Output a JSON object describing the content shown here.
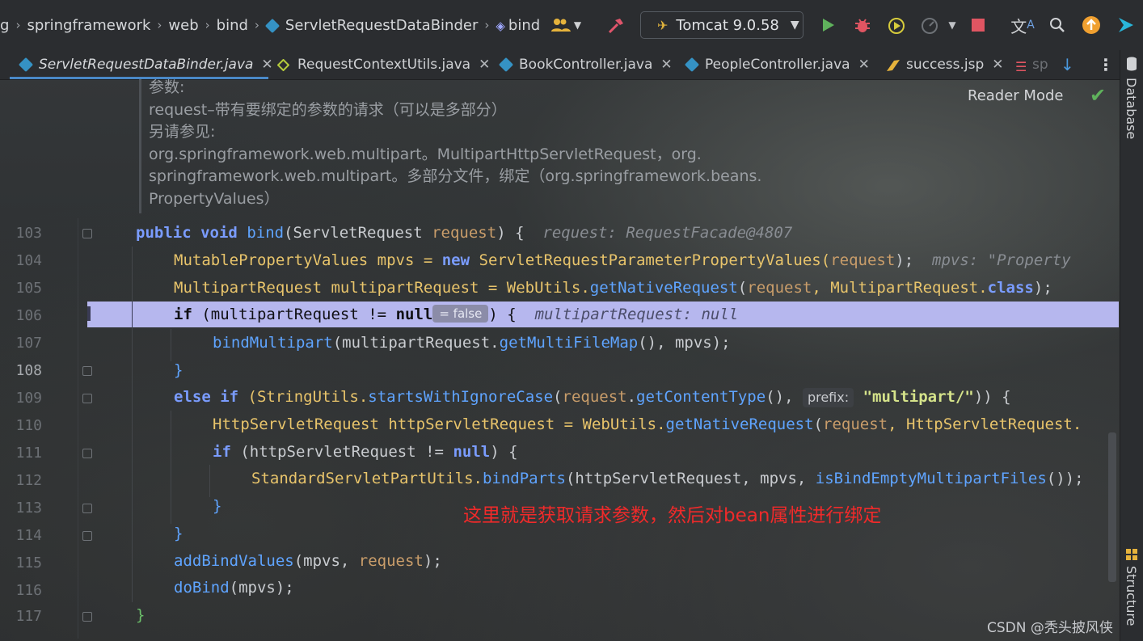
{
  "breadcrumbs": {
    "left_cut": "g",
    "items": [
      "springframework",
      "web",
      "bind",
      "ServletRequestDataBinder",
      "bind"
    ]
  },
  "toolbar": {
    "run_config": "Tomcat 9.0.58"
  },
  "tabs": [
    {
      "label": "ServletRequestDataBinder.java",
      "active": true,
      "icon": "java-class-icon"
    },
    {
      "label": "RequestContextUtils.java",
      "active": false,
      "icon": "java-abstract-class-icon"
    },
    {
      "label": "BookController.java",
      "active": false,
      "icon": "java-class-icon"
    },
    {
      "label": "PeopleController.java",
      "active": false,
      "icon": "java-class-icon"
    },
    {
      "label": "success.jsp",
      "active": false,
      "icon": "jsp-icon"
    },
    {
      "label": "sp",
      "active": false,
      "icon": "list-icon"
    }
  ],
  "side_panels": {
    "database": "Database",
    "structure": "Structure"
  },
  "reader_mode": "Reader Mode",
  "javadoc": [
    "参数:",
    "request–带有要绑定的参数的请求（可以是多部分）",
    "另请参见:",
    "org.springframework.web.multipart。MultipartHttpServletRequest，org.",
    "springframework.web.multipart。多部分文件，绑定（org.springframework.beans.",
    "PropertyValues）"
  ],
  "line_numbers": [
    "103",
    "104",
    "105",
    "106",
    "107",
    "108",
    "109",
    "110",
    "111",
    "112",
    "113",
    "114",
    "115",
    "116",
    "117"
  ],
  "code": {
    "l103": {
      "public": "public",
      "void": "void",
      "name": "bind",
      "params": "(ServletRequest ",
      "param": "request",
      "close": ") {",
      "hint": "request: RequestFacade@4807"
    },
    "l104": {
      "text1": "MutablePropertyValues mpvs = ",
      "new": "new",
      "text2": " ServletRequestParameterPropertyValues(",
      "param": "request",
      "text3": ");",
      "hint": "mpvs: \"Property"
    },
    "l105": {
      "text1": "MultipartRequest multipartRequest = WebUtils.",
      "fn": "getNativeRequest",
      "text2": "(",
      "param": "request",
      "text3": ", MultipartRequest.",
      "cls": "class",
      "text4": ");"
    },
    "l106": {
      "if": "if",
      "text1": " (multipartRequest != ",
      "null": "null",
      "pill": "= false",
      "text2": ") {",
      "hint": "multipartRequest: null"
    },
    "l107": {
      "fn": "bindMultipart",
      "text1": "(multipartRequest.",
      "fn2": "getMultiFileMap",
      "text2": "(), mpvs);"
    },
    "l108": {
      "text": "}"
    },
    "l109": {
      "else": "else",
      "if": "if",
      "text1": " (StringUtils.",
      "fn": "startsWithIgnoreCase",
      "text2": "(",
      "param": "request",
      "text3": ".",
      "fn2": "getContentType",
      "text4": "(), ",
      "prefix": "prefix:",
      "str": "\"multipart/\"",
      "text5": ")) {"
    },
    "l110": {
      "text1": "HttpServletRequest httpServletRequest = WebUtils.",
      "fn": "getNativeRequest",
      "text2": "(",
      "param": "request",
      "text3": ", HttpServletRequest."
    },
    "l111": {
      "if": "if",
      "text1": " (httpServletRequest != ",
      "null": "null",
      "text2": ") {"
    },
    "l112": {
      "text1": "StandardServletPartUtils.",
      "fn": "bindParts",
      "text2": "(httpServletRequest, mpvs, ",
      "fn2": "isBindEmptyMultipartFiles",
      "text3": "());"
    },
    "l113": {
      "text": "}"
    },
    "l114": {
      "text": "}"
    },
    "l115": {
      "fn": "addBindValues",
      "text1": "(mpvs, ",
      "param": "request",
      "text2": ");"
    },
    "l116": {
      "fn": "doBind",
      "text1": "(mpvs);"
    },
    "l117": {
      "text": "}"
    }
  },
  "annotation": "这里就是获取请求参数，然后对bean属性进行绑定",
  "watermark": "CSDN @秃头披风侠",
  "colors": {
    "highlight": "#b6b7ee",
    "annotation": "#ef2a2a",
    "keyword": "#cc7832",
    "method": "#5fa4ff"
  }
}
